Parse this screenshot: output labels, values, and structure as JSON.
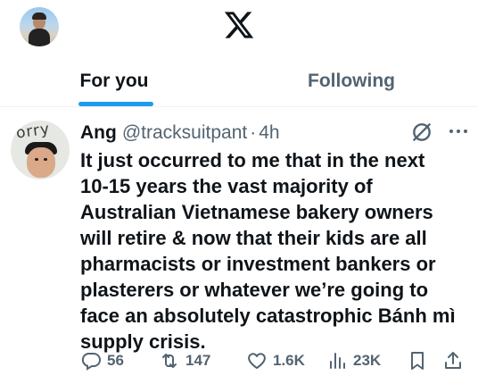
{
  "header": {
    "avatar_icon": "user-avatar",
    "logo_icon": "x-logo"
  },
  "tabs": [
    {
      "label": "For you",
      "selected": true
    },
    {
      "label": "Following",
      "selected": false
    }
  ],
  "tweet": {
    "author_name": "Ang",
    "author_handle": "@tracksuitpant",
    "separator": "·",
    "time": "4h",
    "avatar_text": "orry",
    "text": "It just occurred to me that in the next\n10-15 years the vast majority of\nAustralian Vietnamese bakery owners\nwill retire & now that their kids are all\npharmacists or investment bankers or\nplasterers or whatever we’re going to\nface an absolutely catastrophic Bánh mì\nsupply crisis.",
    "actions": {
      "replies": "56",
      "reposts": "147",
      "likes": "1.6K",
      "views": "23K"
    }
  },
  "colors": {
    "accent": "#1d9bf0",
    "text_primary": "#0f1419",
    "text_secondary": "#536471"
  }
}
